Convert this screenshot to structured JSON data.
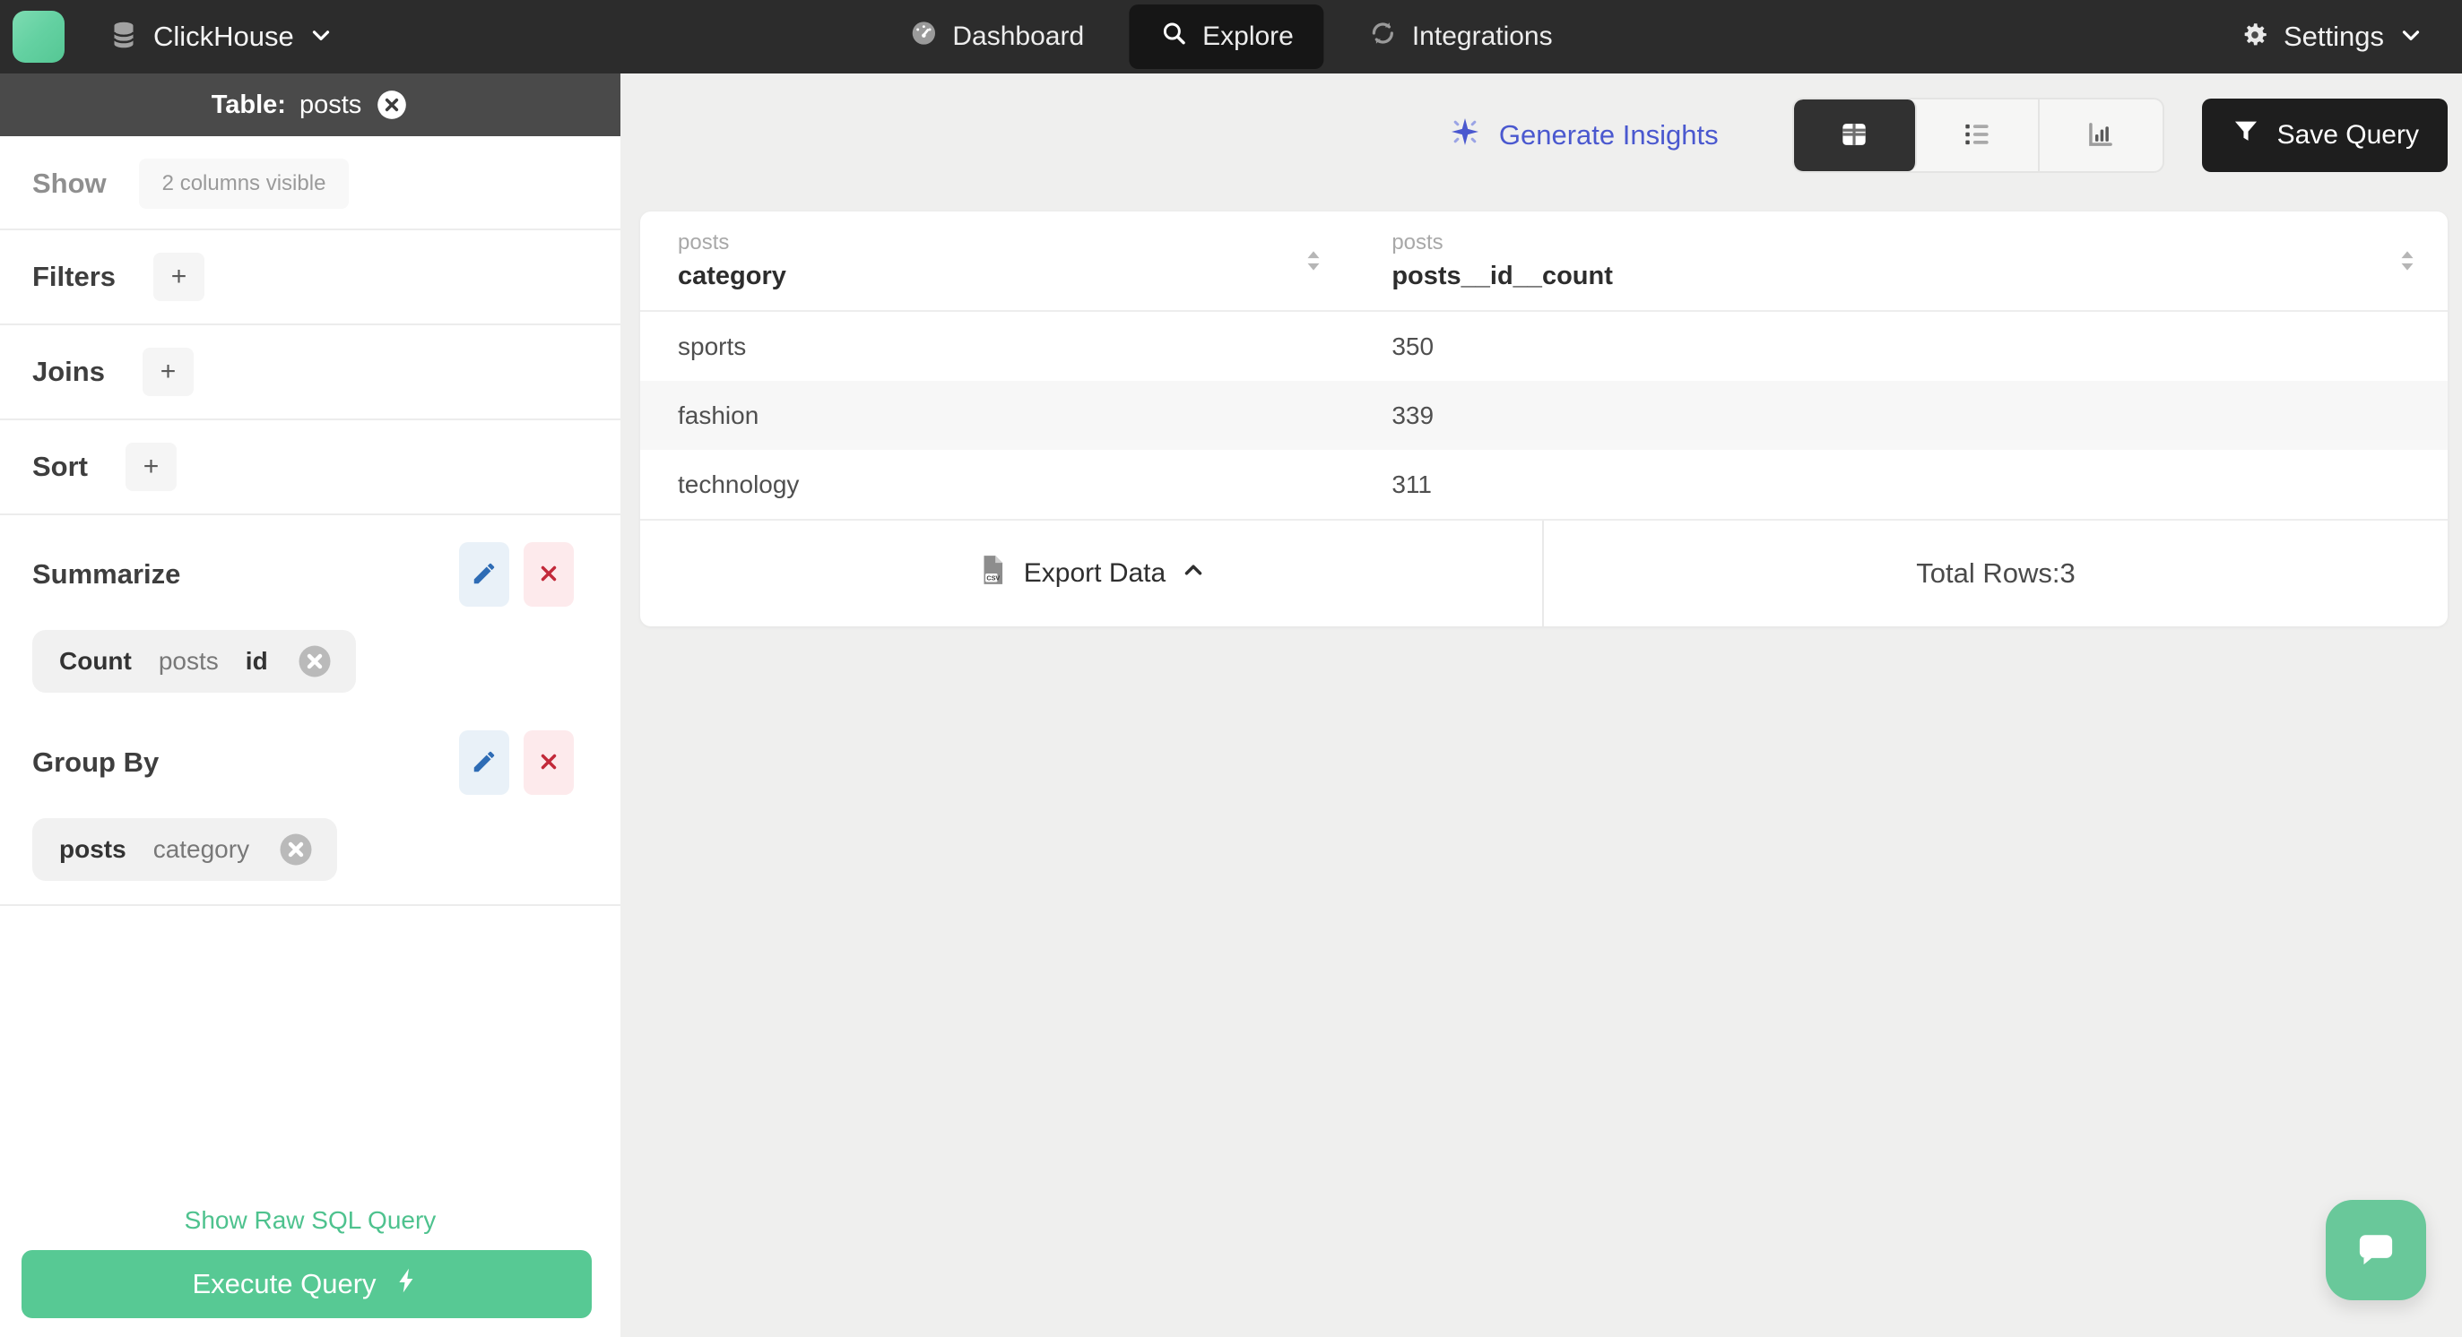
{
  "nav": {
    "brand": {
      "name": "ClickHouse"
    },
    "items": [
      {
        "label": "Dashboard"
      },
      {
        "label": "Explore",
        "active": true
      },
      {
        "label": "Integrations"
      }
    ],
    "settings": {
      "label": "Settings"
    }
  },
  "sidebar": {
    "table_header": {
      "prefix": "Table:",
      "table_name": "posts"
    },
    "show": {
      "label": "Show",
      "chip": "2 columns visible"
    },
    "sections": [
      {
        "label": "Filters",
        "add_label": "+"
      },
      {
        "label": "Joins",
        "add_label": "+"
      },
      {
        "label": "Sort",
        "add_label": "+"
      }
    ],
    "summarize": {
      "label": "Summarize",
      "chip": {
        "agg": "Count",
        "table": "posts",
        "column": "id"
      }
    },
    "group_by": {
      "label": "Group By",
      "chip": {
        "table": "posts",
        "column": "category"
      }
    },
    "raw_sql_link": "Show Raw SQL Query",
    "execute_button": "Execute Query"
  },
  "toolbar": {
    "generate_insights": "Generate Insights",
    "save_query": "Save Query"
  },
  "results": {
    "columns": [
      {
        "group": "posts",
        "name": "category"
      },
      {
        "group": "posts",
        "name": "posts__id__count"
      }
    ],
    "rows": [
      [
        "sports",
        "350"
      ],
      [
        "fashion",
        "339"
      ],
      [
        "technology",
        "311"
      ]
    ],
    "export_label": "Export Data",
    "total_rows_label": "Total Rows:3"
  },
  "colors": {
    "brand_green": "#57c994",
    "link_green": "#4ec28e",
    "accent_indigo": "#4a58cf",
    "nav_dark": "#2c2c2c",
    "sidebar_header_dark": "#4a4a4a",
    "edit_blue": "#2e6cb5",
    "remove_red": "#c2293a"
  }
}
